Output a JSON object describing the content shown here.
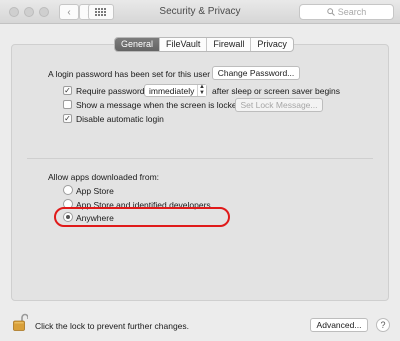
{
  "window": {
    "title": "Security & Privacy",
    "grid_icon": "grid-icon",
    "search_placeholder": "Search"
  },
  "tabs": [
    {
      "label": "General",
      "active": true
    },
    {
      "label": "FileVault",
      "active": false
    },
    {
      "label": "Firewall",
      "active": false
    },
    {
      "label": "Privacy",
      "active": false
    }
  ],
  "general": {
    "login_password_text": "A login password has been set for this user",
    "change_password_button": "Change Password...",
    "require_password": {
      "label": "Require password",
      "checked": true
    },
    "require_password_select": "immediately",
    "require_password_suffix": "after sleep or screen saver begins",
    "show_message": {
      "label": "Show a message when the screen is locked",
      "checked": false
    },
    "set_lock_message_button": "Set Lock Message...",
    "disable_auto_login": {
      "label": "Disable automatic login",
      "checked": true
    }
  },
  "downloads": {
    "heading": "Allow apps downloaded from:",
    "options": [
      {
        "label": "App Store",
        "selected": false
      },
      {
        "label": "App Store and identified developers",
        "selected": false
      },
      {
        "label": "Anywhere",
        "selected": true
      }
    ],
    "highlight_color": "#e01a1a"
  },
  "footer": {
    "lock_text": "Click the lock to prevent further changes.",
    "advanced_button": "Advanced...",
    "help_button": "?"
  }
}
